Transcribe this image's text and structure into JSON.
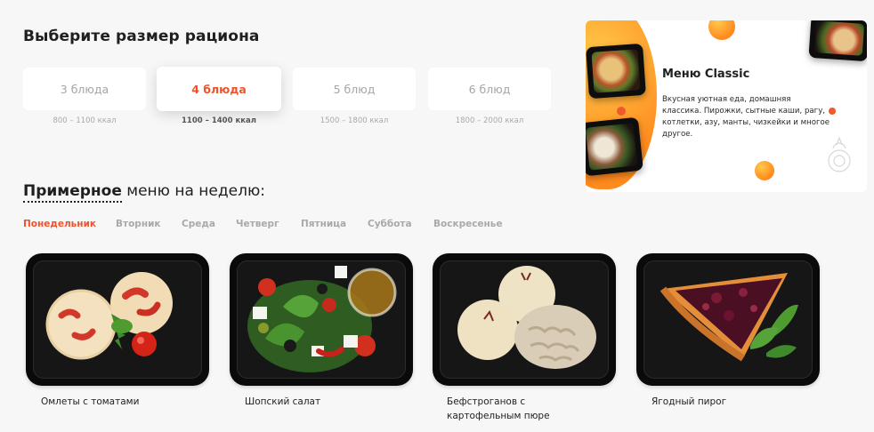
{
  "size_section": {
    "title": "Выберите размер рациона",
    "options": [
      {
        "label": "3 блюда",
        "kcal": "800 – 1100 ккал",
        "selected": false
      },
      {
        "label": "4 блюда",
        "kcal": "1100 – 1400 ккал",
        "selected": true
      },
      {
        "label": "5 блюд",
        "kcal": "1500 – 1800 ккал",
        "selected": false
      },
      {
        "label": "6 блюд",
        "kcal": "1800 – 2000 ккал",
        "selected": false
      }
    ]
  },
  "promo": {
    "title": "Меню Classic",
    "description": "Вкусная уютная еда, домашняя классика. Пирожки, сытные каши, рагу, котлетки, азу, манты, чизкейки и многое другое."
  },
  "weekly_menu": {
    "title_accent": "Примерное",
    "title_rest": " меню на неделю:",
    "days": [
      "Понедельник",
      "Вторник",
      "Среда",
      "Четверг",
      "Пятница",
      "Суббота",
      "Воскресенье"
    ],
    "active_day": "Понедельник",
    "dishes": [
      {
        "name": "Омлеты с томатами"
      },
      {
        "name": "Шопский салат"
      },
      {
        "name": "Бефстроганов с картофельным пюре"
      },
      {
        "name": "Ягодный пирог"
      }
    ]
  },
  "colors": {
    "accent": "#f0522a",
    "muted_text": "#a9a9a9",
    "background": "#f7f7f7",
    "card": "#ffffff",
    "tray": "#0a0a0a"
  }
}
